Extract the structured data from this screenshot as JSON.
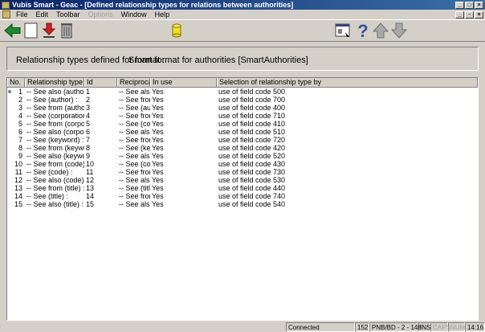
{
  "window": {
    "title": "Vubis Smart - Geac - [Defined relationship types for relations between authorities]"
  },
  "menu": {
    "items": [
      "File",
      "Edit",
      "Toolbar",
      "Options",
      "Window",
      "Help"
    ],
    "disabled_index": 3
  },
  "toolbar": {
    "icons": [
      "back-arrow-icon",
      "new-document-icon",
      "download-arrow-icon",
      "trash-icon",
      "cylinder-icon",
      "window-icon",
      "help-icon",
      "up-arrow-icon",
      "down-arrow-icon"
    ]
  },
  "header_panel": {
    "label": "Relationship types defined for format :",
    "value": "Smart format for authorities [SmartAuthorities]"
  },
  "table": {
    "columns": [
      "No.",
      "Relationship type",
      "Id",
      "Reciprocal",
      "In use",
      "Selection of relationship type by"
    ],
    "rows": [
      [
        "1",
        "-- See also (author) :",
        "1",
        "-- See also",
        "Yes",
        "use of field code 500"
      ],
      [
        "2",
        "-- See (author) :",
        "2",
        "-- See from",
        "Yes",
        "use of field code 700"
      ],
      [
        "3",
        "-- See from (author) :",
        "3",
        "-- See (aut",
        "Yes",
        "use of field code 400"
      ],
      [
        "4",
        "-- See (corporation) :",
        "4",
        "-- See from",
        "Yes",
        "use of field code 710"
      ],
      [
        "5",
        "-- See from (corporat",
        "5",
        "-- See (cor",
        "Yes",
        "use of field code 410"
      ],
      [
        "6",
        "-- See also (corporati",
        "6",
        "-- See also",
        "Yes",
        "use of field code 510"
      ],
      [
        "7",
        "-- See (keyword) :",
        "7",
        "-- See from",
        "Yes",
        "use of field code 720"
      ],
      [
        "8",
        "-- See from (keyword",
        "8",
        "-- See (key",
        "Yes",
        "use of field code 420"
      ],
      [
        "9",
        "-- See also (keyword",
        "9",
        "-- See also",
        "Yes",
        "use of field code 520"
      ],
      [
        "10",
        "-- See from (code) :",
        "10",
        "-- See (cod",
        "Yes",
        "use of field code 430"
      ],
      [
        "11",
        "-- See (code) :",
        "11",
        "-- See from",
        "Yes",
        "use of field code 730"
      ],
      [
        "12",
        "-- See also (code) :",
        "12",
        "-- See also",
        "Yes",
        "use of field code 530"
      ],
      [
        "13",
        "-- See from (title) :",
        "13",
        "-- See (title",
        "Yes",
        "use of field code 440"
      ],
      [
        "14",
        "-- See (title) :",
        "14",
        "-- See from",
        "Yes",
        "use of field code 740"
      ],
      [
        "15",
        "-- See also (title) :",
        "15",
        "-- See also",
        "Yes",
        "use of field code 540"
      ]
    ]
  },
  "statusbar": {
    "connection": "Connected",
    "count": "152",
    "session": "PNB/BD - 2 - 148",
    "ins": "INS",
    "caps": "CAPS",
    "num": "NUM",
    "time": "14:16"
  }
}
